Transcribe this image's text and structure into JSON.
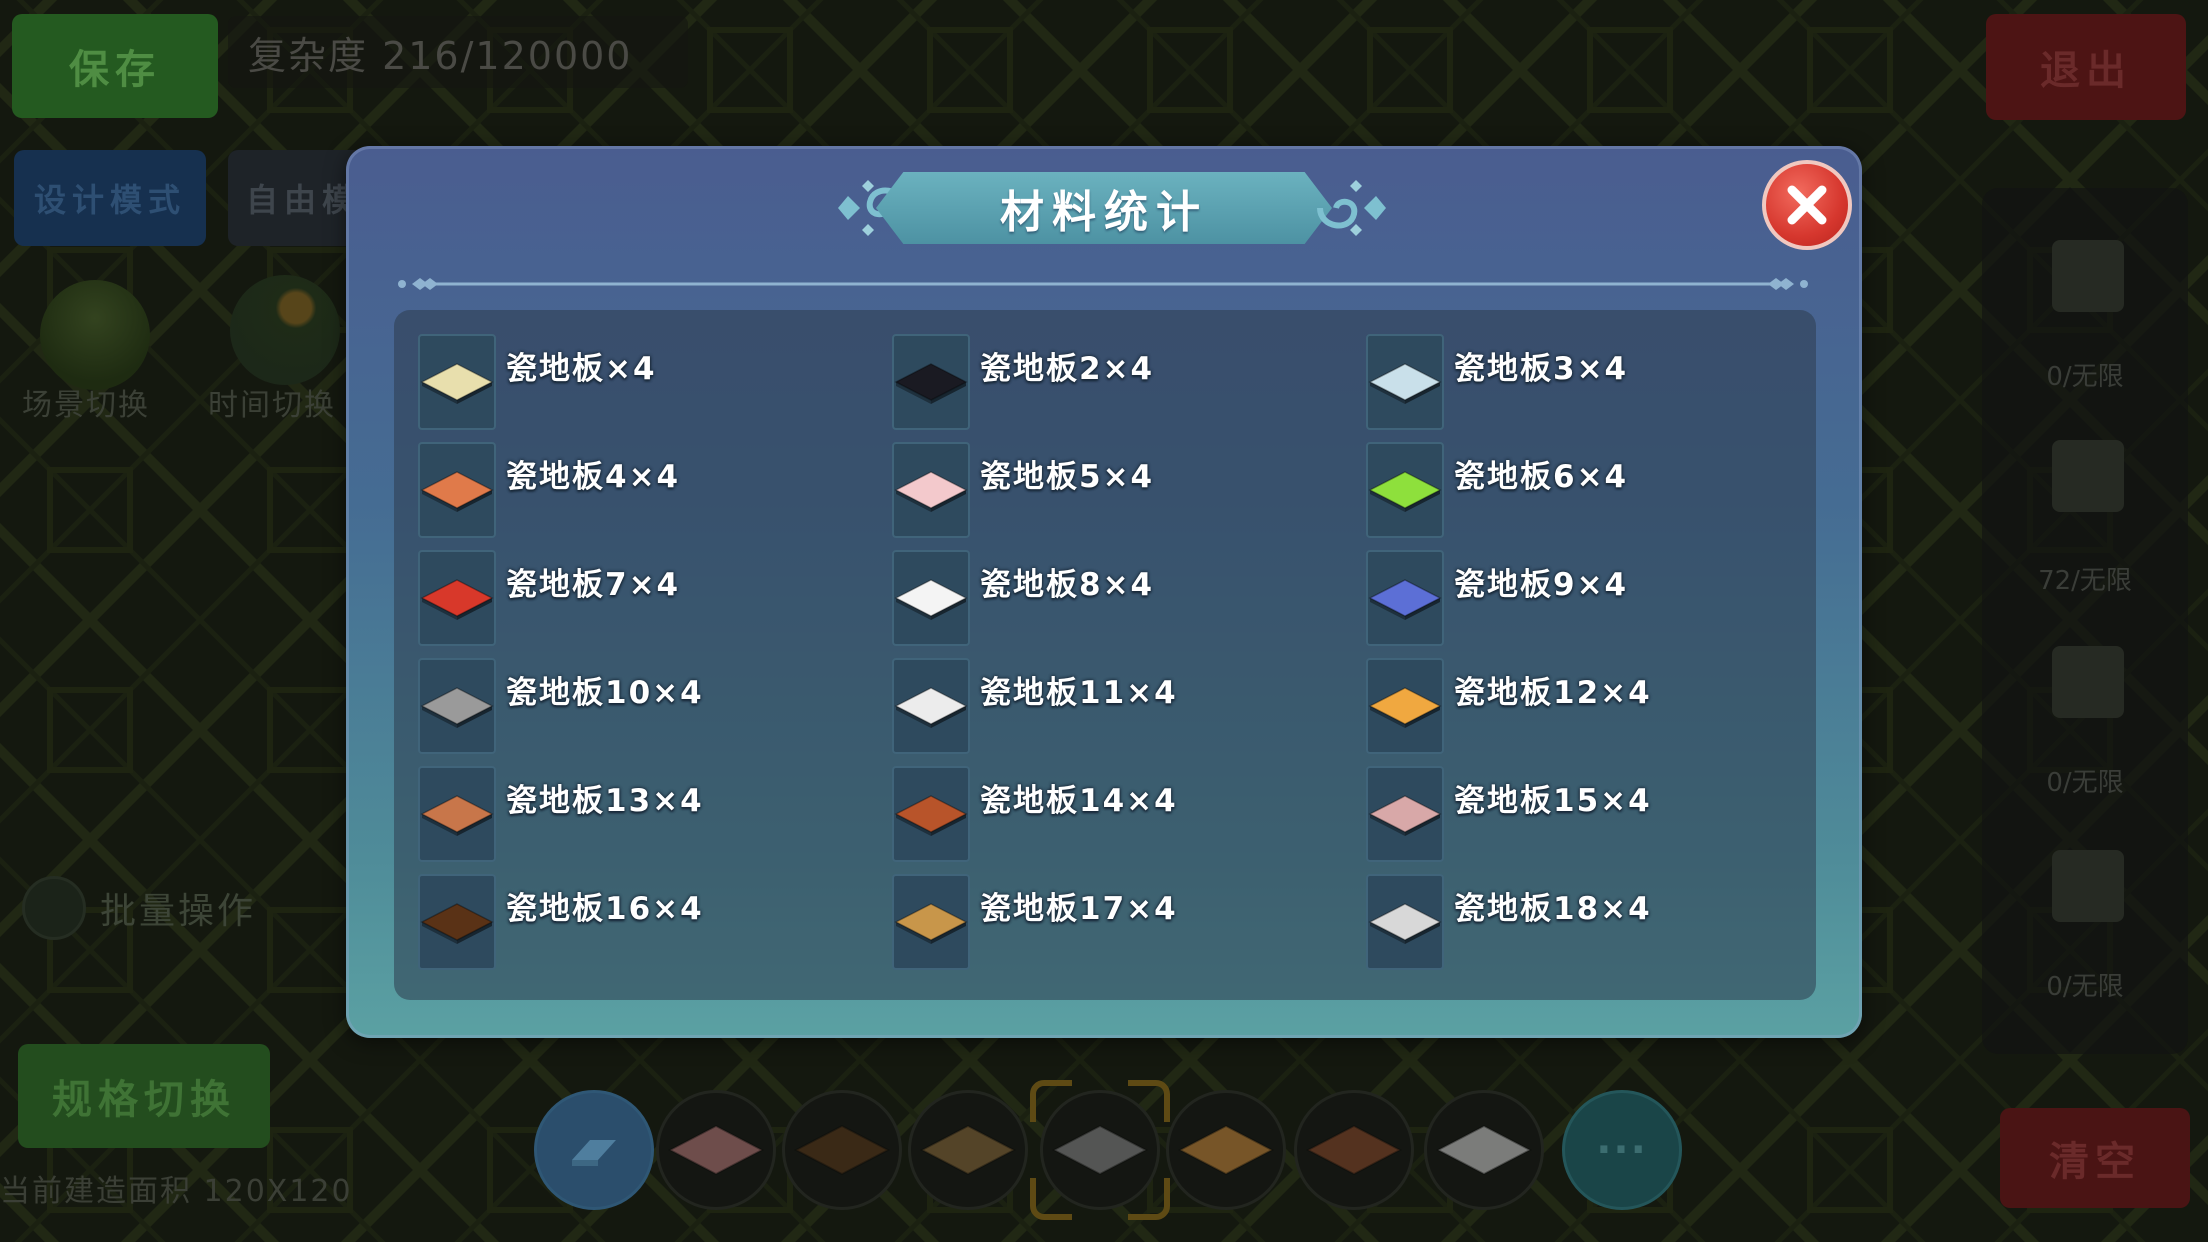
{
  "background": {
    "save_label": "保存",
    "complexity_text": "复杂度 216/120000",
    "exit_label": "退出",
    "design_mode_label": "设计模式",
    "free_mode_label": "自由模",
    "scene_switch_label": "场景切换",
    "time_switch_label": "时间切换",
    "batch_label": "批量操作",
    "spec_switch_label": "规格切换",
    "area_text": "当前建造面积 120X120",
    "clear_label": "清空",
    "right_panel_counts": [
      "0/无限",
      "72/无限",
      "0/无限",
      "0/无限"
    ]
  },
  "dialog": {
    "title": "材料统计",
    "items": [
      {
        "label": "瓷地板×4",
        "color": "#e8dfad"
      },
      {
        "label": "瓷地板2×4",
        "color": "#1a1a22"
      },
      {
        "label": "瓷地板3×4",
        "color": "#c9e0ea"
      },
      {
        "label": "瓷地板4×4",
        "color": "#e07a4a"
      },
      {
        "label": "瓷地板5×4",
        "color": "#f3c9cc"
      },
      {
        "label": "瓷地板6×4",
        "color": "#8ee03c"
      },
      {
        "label": "瓷地板7×4",
        "color": "#d8382a"
      },
      {
        "label": "瓷地板8×4",
        "color": "#f4f4f4"
      },
      {
        "label": "瓷地板9×4",
        "color": "#5c6fd6"
      },
      {
        "label": "瓷地板10×4",
        "color": "#9a9a9a"
      },
      {
        "label": "瓷地板11×4",
        "color": "#ececec"
      },
      {
        "label": "瓷地板12×4",
        "color": "#f0a840"
      },
      {
        "label": "瓷地板13×4",
        "color": "#c8764a"
      },
      {
        "label": "瓷地板14×4",
        "color": "#b8542a"
      },
      {
        "label": "瓷地板15×4",
        "color": "#d8a8a8"
      },
      {
        "label": "瓷地板16×4",
        "color": "#5a3216"
      },
      {
        "label": "瓷地板17×4",
        "color": "#c8964a"
      },
      {
        "label": "瓷地板18×4",
        "color": "#d8d8d8"
      }
    ]
  },
  "toolbar": {
    "slot_colors": [
      "#b87a7a",
      "#5a3a1a",
      "#8a6a3a",
      "#8a8a8a",
      "#c88a3a",
      "#8a4a2a",
      "#d0d0d0"
    ],
    "more_label": "···"
  }
}
